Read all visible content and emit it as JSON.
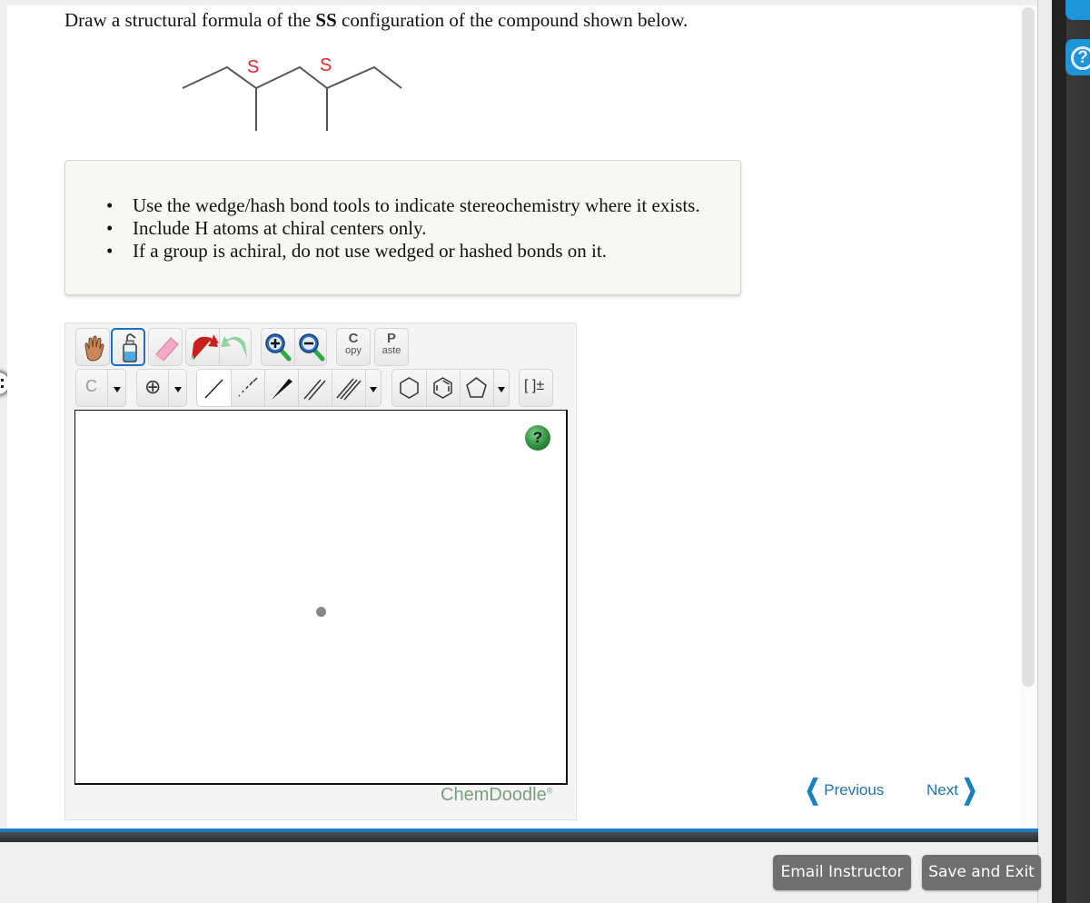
{
  "question": {
    "prefix": "Draw a structural formula of the ",
    "bold": "SS",
    "suffix": " configuration of the compound shown below."
  },
  "molecule": {
    "stereo_labels": [
      "S",
      "S"
    ],
    "label_color": "#e8242c"
  },
  "instructions": [
    "Use the wedge/hash bond tools to indicate stereochemistry where it exists.",
    "Include H atoms at chiral centers only.",
    "If a group is achiral, do not use wedged or hashed bonds on it."
  ],
  "editor": {
    "toolbar_row1": [
      "hand-tool",
      "lasso-tool",
      "eraser-tool",
      "undo",
      "redo",
      "zoom-in",
      "zoom-out",
      "copy",
      "paste"
    ],
    "copy": {
      "big": "C",
      "small": "opy"
    },
    "paste": {
      "big": "P",
      "small": "aste"
    },
    "atom_label": "C",
    "charge_label": "⊕",
    "bracket_label": "[ ]±",
    "help_label": "?",
    "brand": "ChemDoodle",
    "brand_mark": "®"
  },
  "navigation": {
    "previous": "Previous",
    "next": "Next"
  },
  "footer": {
    "email_instructor": "Email Instructor",
    "save_and_exit": "Save and Exit"
  },
  "side": {
    "help_icon": "?"
  },
  "colors": {
    "accent": "#1b7dc2",
    "button_gray": "#6f6f6f",
    "brand_green": "#7a9e7e"
  }
}
